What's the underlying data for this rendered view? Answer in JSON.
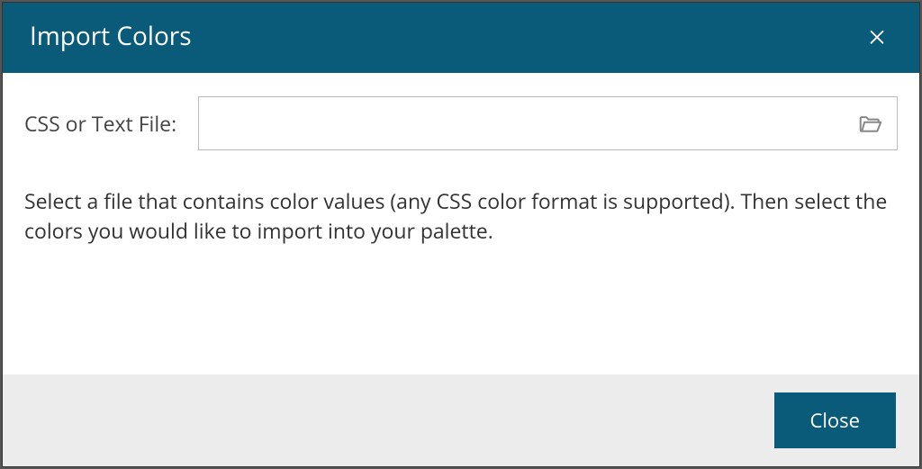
{
  "dialog": {
    "title": "Import Colors",
    "file_label": "CSS or Text File:",
    "file_value": "",
    "instructions": "Select a file that contains color values (any CSS color format is supported). Then select the colors you would like to import into your palette.",
    "close_button": "Close"
  }
}
